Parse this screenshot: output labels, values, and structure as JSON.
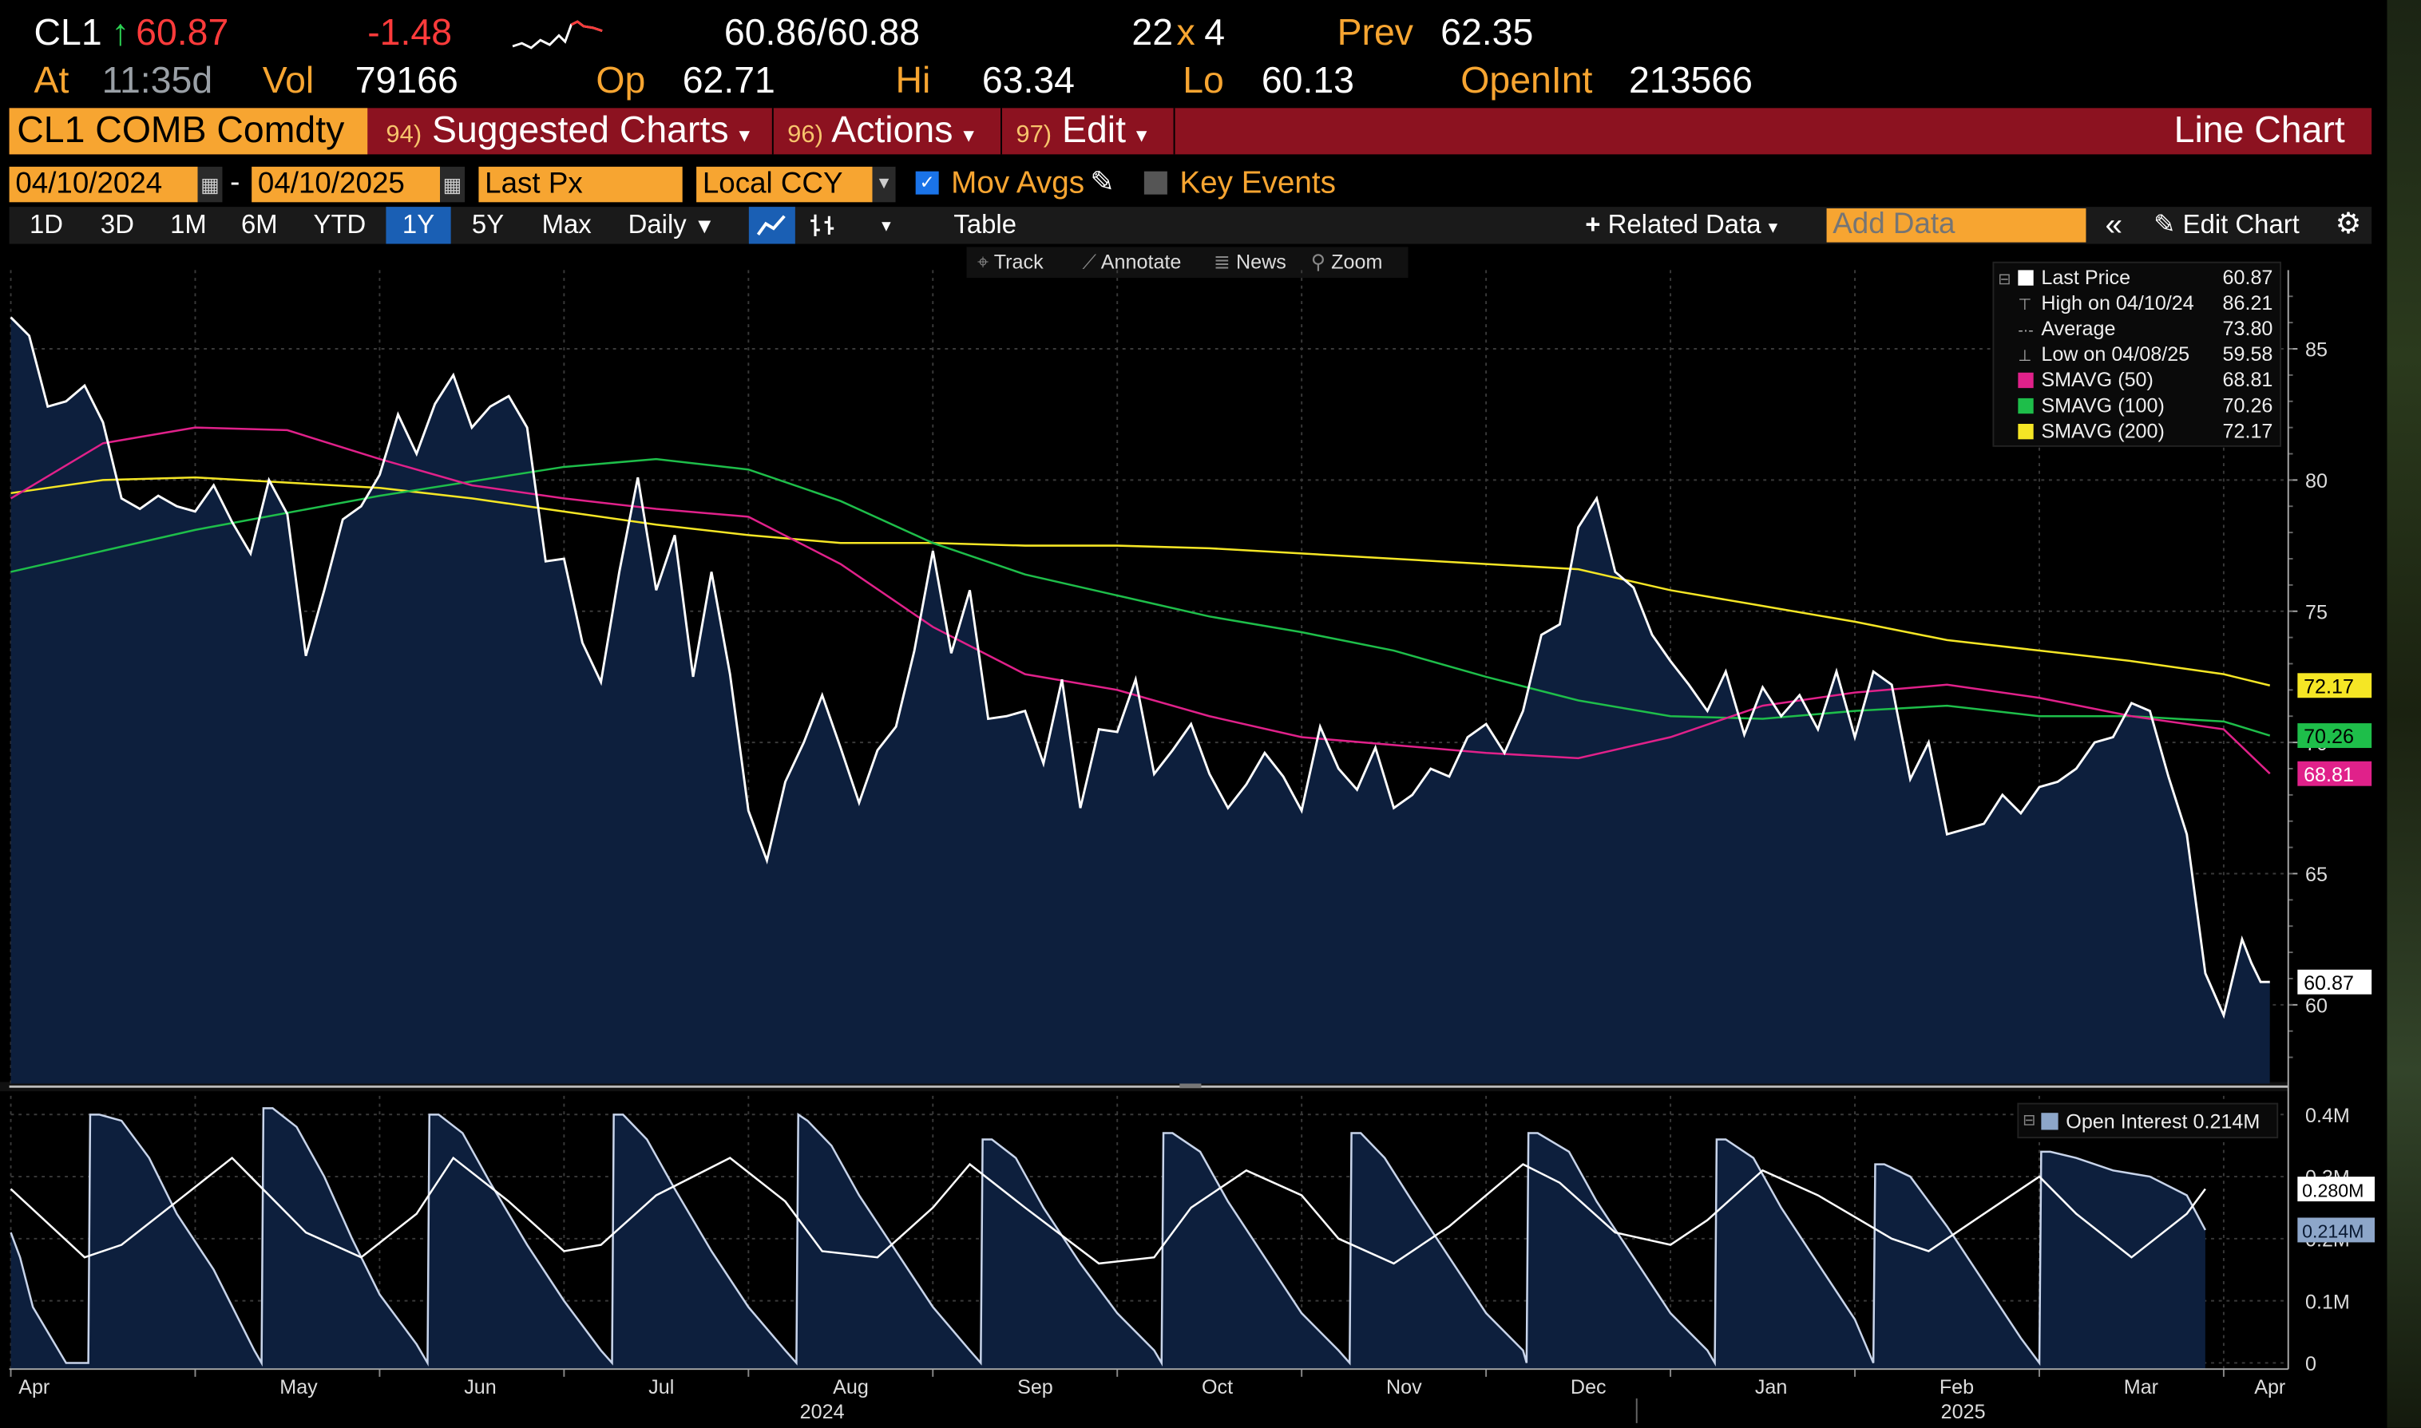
{
  "quote": {
    "ticker": "CL1",
    "arrow": "↑",
    "last": "60.87",
    "change": "-1.48",
    "bid_ask": "60.86/60.88",
    "size_bid": "22",
    "size_x": "x",
    "size_ask": "4",
    "prev_label": "Prev",
    "prev": "62.35",
    "at_label": "At",
    "time": "11:35d",
    "vol_label": "Vol",
    "vol": "79166",
    "op_label": "Op",
    "op": "62.71",
    "hi_label": "Hi",
    "hi": "63.34",
    "lo_label": "Lo",
    "lo": "60.13",
    "openint_label": "OpenInt",
    "openint": "213566"
  },
  "menubar": {
    "security": "CL1 COMB Comdty",
    "items": [
      {
        "num": "94)",
        "label": "Suggested Charts",
        "caret": "▾"
      },
      {
        "num": "96)",
        "label": "Actions",
        "caret": "▾"
      },
      {
        "num": "97)",
        "label": "Edit",
        "caret": "▾"
      }
    ],
    "title": "Line Chart"
  },
  "controls": {
    "start_date": "04/10/2024",
    "dash": "-",
    "end_date": "04/10/2025",
    "field": "Last Px",
    "currency": "Local CCY",
    "mov_avgs": "Mov Avgs",
    "key_events": "Key Events"
  },
  "periods": {
    "buttons": [
      "1D",
      "3D",
      "1M",
      "6M",
      "YTD",
      "1Y",
      "5Y",
      "Max"
    ],
    "active": "1Y",
    "frequency": "Daily",
    "table": "Table",
    "related_data": "Related Data",
    "add_data_placeholder": "Add Data",
    "edit_chart": "Edit Chart"
  },
  "toolbox": {
    "track": "Track",
    "annotate": "Annotate",
    "news": "News",
    "zoom": "Zoom"
  },
  "colors": {
    "price": "#ffffff",
    "area_fill": "#0d1f3d",
    "sma50": "#e0218a",
    "sma100": "#1ebe4a",
    "sma200": "#f5e625",
    "accent": "#f7a531",
    "menubar": "#8c1220"
  },
  "chart_data": [
    {
      "type": "line",
      "name": "price-panel",
      "x_axis": {
        "months": [
          "Apr",
          "May",
          "Jun",
          "Jul",
          "Aug",
          "Sep",
          "Oct",
          "Nov",
          "Dec",
          "Jan",
          "Feb",
          "Mar",
          "Apr"
        ],
        "month_index": [
          0,
          1,
          2,
          3,
          4,
          5,
          6,
          7,
          8,
          9,
          10,
          11,
          12
        ],
        "years": [
          "2024",
          "2025"
        ],
        "x_range": [
          0,
          12.35
        ]
      },
      "y_axis": {
        "ticks": [
          60,
          65,
          70,
          75,
          80,
          85
        ],
        "ylim": [
          57,
          88
        ],
        "side": "right"
      },
      "legend": {
        "placement": "top-right",
        "entries": [
          {
            "label": "Last Price",
            "value": "60.87"
          },
          {
            "label": "High on 04/10/24",
            "value": "86.21"
          },
          {
            "label": "Average",
            "value": "73.80"
          },
          {
            "label": "Low on 04/08/25",
            "value": "59.58"
          },
          {
            "label": "SMAVG (50)",
            "value": "68.81"
          },
          {
            "label": "SMAVG (100)",
            "value": "70.26"
          },
          {
            "label": "SMAVG (200)",
            "value": "72.17"
          }
        ]
      },
      "series": [
        {
          "name": "Last Price",
          "x": [
            0,
            0.1,
            0.2,
            0.3,
            0.4,
            0.5,
            0.6,
            0.7,
            0.8,
            0.9,
            1.0,
            1.1,
            1.2,
            1.3,
            1.4,
            1.5,
            1.6,
            1.7,
            1.8,
            1.9,
            2.0,
            2.1,
            2.2,
            2.3,
            2.4,
            2.5,
            2.6,
            2.7,
            2.8,
            2.9,
            3.0,
            3.1,
            3.2,
            3.3,
            3.4,
            3.5,
            3.6,
            3.7,
            3.8,
            3.9,
            4.0,
            4.1,
            4.2,
            4.3,
            4.4,
            4.5,
            4.6,
            4.7,
            4.8,
            4.9,
            5.0,
            5.1,
            5.2,
            5.3,
            5.4,
            5.5,
            5.6,
            5.7,
            5.8,
            5.9,
            6.0,
            6.1,
            6.2,
            6.3,
            6.4,
            6.5,
            6.6,
            6.7,
            6.8,
            6.9,
            7.0,
            7.1,
            7.2,
            7.3,
            7.4,
            7.5,
            7.6,
            7.7,
            7.8,
            7.9,
            8.0,
            8.1,
            8.2,
            8.3,
            8.4,
            8.5,
            8.6,
            8.7,
            8.8,
            8.9,
            9.0,
            9.1,
            9.2,
            9.3,
            9.4,
            9.5,
            9.6,
            9.7,
            9.8,
            9.9,
            10.0,
            10.1,
            10.2,
            10.3,
            10.4,
            10.5,
            10.6,
            10.7,
            10.8,
            10.9,
            11.0,
            11.1,
            11.2,
            11.3,
            11.4,
            11.5,
            11.6,
            11.7,
            11.8,
            11.9,
            12.0,
            12.1,
            12.15,
            12.2,
            12.25
          ],
          "values": [
            86.2,
            85.5,
            82.8,
            83.0,
            83.6,
            82.2,
            79.3,
            78.9,
            79.4,
            79.0,
            78.8,
            79.8,
            78.4,
            77.2,
            80.0,
            78.7,
            73.3,
            75.8,
            78.5,
            79.0,
            80.2,
            82.5,
            81.0,
            82.9,
            84.0,
            82.0,
            82.8,
            83.2,
            82.0,
            76.9,
            77.0,
            73.8,
            72.3,
            76.5,
            80.1,
            75.8,
            77.9,
            72.5,
            76.5,
            72.6,
            67.4,
            65.5,
            68.5,
            70.0,
            71.8,
            69.8,
            67.7,
            69.7,
            70.6,
            73.5,
            77.3,
            73.4,
            75.8,
            70.9,
            71.0,
            71.2,
            69.2,
            72.4,
            67.5,
            70.5,
            70.4,
            72.4,
            68.8,
            69.7,
            70.7,
            68.8,
            67.5,
            68.4,
            69.6,
            68.7,
            67.4,
            70.6,
            69.0,
            68.2,
            69.8,
            67.5,
            68.0,
            69.0,
            68.7,
            70.2,
            70.7,
            69.6,
            71.2,
            74.1,
            74.5,
            78.2,
            79.3,
            76.5,
            75.9,
            74.1,
            73.1,
            72.2,
            71.2,
            72.7,
            70.3,
            72.1,
            71.0,
            71.8,
            70.5,
            72.7,
            70.2,
            72.7,
            72.2,
            68.6,
            70.0,
            66.5,
            66.7,
            66.9,
            68.0,
            67.3,
            68.3,
            68.5,
            69.0,
            70.0,
            70.2,
            71.5,
            71.2,
            68.7,
            66.5,
            61.2,
            59.6,
            62.5,
            61.6,
            60.87,
            60.87
          ]
        },
        {
          "name": "SMAVG (50)",
          "x": [
            0,
            0.5,
            1.0,
            1.5,
            2.0,
            2.5,
            3.0,
            3.5,
            4.0,
            4.5,
            5.0,
            5.5,
            6.0,
            6.5,
            7.0,
            7.5,
            8.0,
            8.5,
            9.0,
            9.5,
            10.0,
            10.5,
            11.0,
            11.5,
            12.0,
            12.25
          ],
          "values": [
            79.3,
            81.4,
            82.0,
            81.9,
            80.8,
            79.8,
            79.3,
            78.9,
            78.6,
            76.8,
            74.4,
            72.6,
            72.0,
            71.0,
            70.2,
            69.9,
            69.6,
            69.4,
            70.2,
            71.4,
            71.9,
            72.2,
            71.7,
            71.0,
            70.5,
            68.81
          ]
        },
        {
          "name": "SMAVG (100)",
          "x": [
            0,
            1.0,
            2.0,
            3.0,
            3.5,
            4.0,
            4.5,
            5.0,
            5.5,
            6.0,
            6.5,
            7.0,
            7.5,
            8.0,
            8.5,
            9.0,
            9.5,
            10.0,
            10.5,
            11.0,
            11.5,
            12.0,
            12.25
          ],
          "values": [
            76.5,
            78.1,
            79.4,
            80.5,
            80.8,
            80.4,
            79.2,
            77.6,
            76.4,
            75.6,
            74.8,
            74.2,
            73.5,
            72.5,
            71.6,
            71.0,
            70.9,
            71.2,
            71.4,
            71.0,
            71.0,
            70.8,
            70.26
          ]
        },
        {
          "name": "SMAVG (200)",
          "x": [
            0,
            0.5,
            1.0,
            1.5,
            2.0,
            2.5,
            3.0,
            3.5,
            4.0,
            4.5,
            5.0,
            5.5,
            6.0,
            6.5,
            7.0,
            7.5,
            8.0,
            8.5,
            9.0,
            9.5,
            10.0,
            10.5,
            11.0,
            11.5,
            12.0,
            12.25
          ],
          "values": [
            79.5,
            80.0,
            80.1,
            79.9,
            79.7,
            79.3,
            78.8,
            78.3,
            77.9,
            77.6,
            77.6,
            77.5,
            77.5,
            77.4,
            77.2,
            77.0,
            76.8,
            76.6,
            75.8,
            75.2,
            74.6,
            73.9,
            73.5,
            73.1,
            72.6,
            72.17
          ]
        }
      ]
    },
    {
      "type": "area",
      "name": "open-interest-panel",
      "y_axis": {
        "ticks": [
          "0",
          "0.1M",
          "0.2M",
          "0.3M",
          "0.4M"
        ],
        "tick_values": [
          0,
          0.1,
          0.2,
          0.3,
          0.4
        ],
        "ylim": [
          -0.01,
          0.43
        ],
        "side": "right"
      },
      "legend": {
        "placement": "top-right",
        "entries": [
          {
            "label": "Open Interest",
            "value": "0.214M"
          }
        ]
      },
      "last_labels": [
        "0.280M",
        "0.214M"
      ],
      "series": [
        {
          "name": "Open Interest",
          "x": [
            0,
            0.05,
            0.12,
            0.3,
            0.42,
            0.43,
            0.48,
            0.6,
            0.75,
            0.9,
            1.1,
            1.32,
            1.36,
            1.37,
            1.42,
            1.55,
            1.7,
            1.85,
            2.0,
            2.2,
            2.26,
            2.27,
            2.32,
            2.45,
            2.6,
            2.8,
            3.0,
            3.2,
            3.26,
            3.27,
            3.32,
            3.45,
            3.6,
            3.8,
            4.0,
            4.2,
            4.26,
            4.27,
            4.32,
            4.45,
            4.6,
            4.8,
            5.0,
            5.2,
            5.26,
            5.27,
            5.32,
            5.45,
            5.6,
            5.8,
            6.0,
            6.2,
            6.24,
            6.25,
            6.3,
            6.45,
            6.6,
            6.8,
            7.0,
            7.2,
            7.26,
            7.27,
            7.32,
            7.45,
            7.6,
            7.8,
            8.0,
            8.2,
            8.22,
            8.23,
            8.28,
            8.45,
            8.6,
            8.8,
            9.0,
            9.2,
            9.24,
            9.25,
            9.3,
            9.45,
            9.6,
            9.8,
            10.0,
            10.1,
            10.11,
            10.16,
            10.3,
            10.5,
            10.7,
            10.9,
            11.0,
            11.01,
            11.06,
            11.2,
            11.4,
            11.6,
            11.8,
            11.9
          ],
          "values": [
            0.21,
            0.17,
            0.09,
            0.0,
            0.0,
            0.4,
            0.4,
            0.39,
            0.33,
            0.24,
            0.15,
            0.02,
            0.0,
            0.41,
            0.41,
            0.38,
            0.3,
            0.2,
            0.11,
            0.03,
            0.0,
            0.4,
            0.4,
            0.37,
            0.29,
            0.19,
            0.1,
            0.02,
            0.0,
            0.4,
            0.4,
            0.36,
            0.28,
            0.18,
            0.09,
            0.02,
            0.0,
            0.4,
            0.39,
            0.35,
            0.27,
            0.18,
            0.09,
            0.02,
            0.0,
            0.36,
            0.36,
            0.33,
            0.25,
            0.16,
            0.08,
            0.02,
            0.0,
            0.37,
            0.37,
            0.34,
            0.26,
            0.17,
            0.08,
            0.02,
            0.0,
            0.37,
            0.37,
            0.33,
            0.26,
            0.17,
            0.08,
            0.02,
            0.0,
            0.37,
            0.37,
            0.34,
            0.26,
            0.17,
            0.08,
            0.02,
            0.0,
            0.36,
            0.36,
            0.33,
            0.25,
            0.16,
            0.07,
            0.0,
            0.32,
            0.32,
            0.3,
            0.22,
            0.13,
            0.04,
            0.0,
            0.34,
            0.34,
            0.33,
            0.31,
            0.3,
            0.27,
            0.214
          ]
        },
        {
          "name": "Avg",
          "x": [
            0,
            0.4,
            0.6,
            0.9,
            1.2,
            1.3,
            1.6,
            1.9,
            2.2,
            2.4,
            2.7,
            3.0,
            3.2,
            3.5,
            3.9,
            4.2,
            4.4,
            4.7,
            5.0,
            5.2,
            5.5,
            5.9,
            6.2,
            6.4,
            6.7,
            7.0,
            7.2,
            7.5,
            7.8,
            8.2,
            8.4,
            8.7,
            9.0,
            9.2,
            9.5,
            9.8,
            10.2,
            10.4,
            10.7,
            11.0,
            11.2,
            11.5,
            11.8,
            11.9
          ],
          "values": [
            0.28,
            0.17,
            0.19,
            0.26,
            0.33,
            0.3,
            0.21,
            0.17,
            0.24,
            0.33,
            0.26,
            0.18,
            0.19,
            0.27,
            0.33,
            0.26,
            0.18,
            0.17,
            0.25,
            0.32,
            0.25,
            0.16,
            0.17,
            0.25,
            0.31,
            0.27,
            0.2,
            0.16,
            0.22,
            0.32,
            0.29,
            0.21,
            0.19,
            0.23,
            0.31,
            0.27,
            0.2,
            0.18,
            0.24,
            0.3,
            0.24,
            0.17,
            0.24,
            0.28
          ]
        }
      ]
    }
  ]
}
